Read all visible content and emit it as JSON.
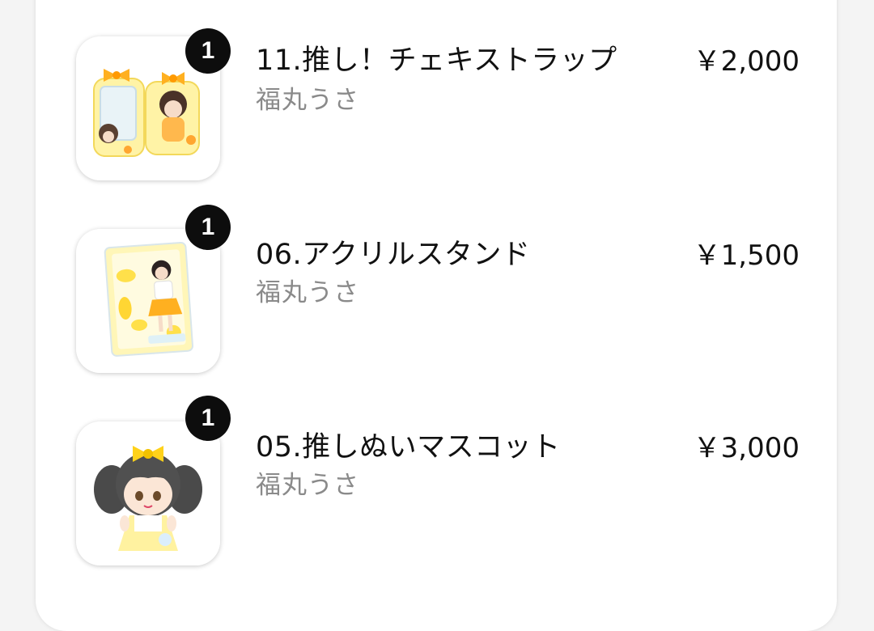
{
  "cart": {
    "items": [
      {
        "badge_count": "1",
        "name": "11.推し！チェキストラップ",
        "artist": "福丸うさ",
        "price": "￥2,000",
        "image_icon": "cheki-strap-product-image"
      },
      {
        "badge_count": "1",
        "name": "06.アクリルスタンド",
        "artist": "福丸うさ",
        "price": "￥1,500",
        "image_icon": "acrylic-stand-product-image"
      },
      {
        "badge_count": "1",
        "name": "05.推しぬいマスコット",
        "artist": "福丸うさ",
        "price": "￥3,000",
        "image_icon": "plush-mascot-product-image"
      }
    ]
  },
  "colors": {
    "badge_bg": "#0d0d0d",
    "accent_yellow": "#ffe45c",
    "artist_text": "#8a8a8a"
  }
}
